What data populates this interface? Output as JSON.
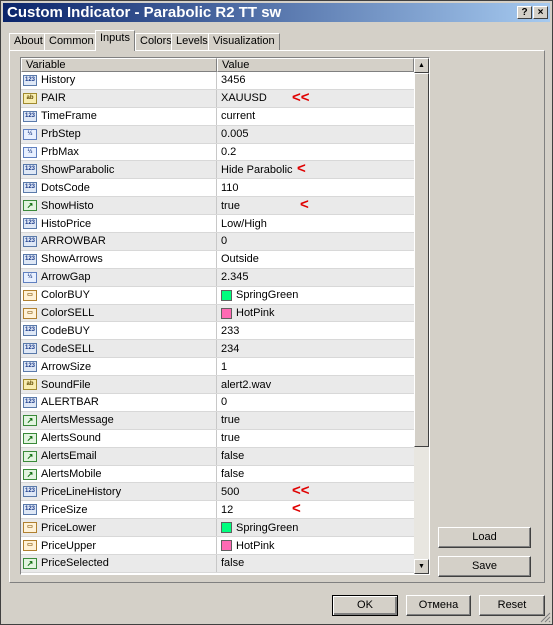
{
  "window": {
    "title": "Custom Indicator - Parabolic R2 TT sw",
    "help_label": "?",
    "close_label": "×"
  },
  "tabs": [
    "About",
    "Common",
    "Inputs",
    "Colors",
    "Levels",
    "Visualization"
  ],
  "active_tab": "Inputs",
  "columns": {
    "variable": "Variable",
    "value": "Value"
  },
  "rows": [
    {
      "variable": "History",
      "value": "3456",
      "type": "int"
    },
    {
      "variable": "PAIR",
      "value": "XAUUSD",
      "type": "str",
      "mark": "<<"
    },
    {
      "variable": "TimeFrame",
      "value": "current",
      "type": "int"
    },
    {
      "variable": "PrbStep",
      "value": "0.005",
      "type": "dbl"
    },
    {
      "variable": "PrbMax",
      "value": "0.2",
      "type": "dbl"
    },
    {
      "variable": "ShowParabolic",
      "value": "Hide Parabolic",
      "type": "int",
      "mark": "<"
    },
    {
      "variable": "DotsCode",
      "value": "110",
      "type": "int"
    },
    {
      "variable": "ShowHisto",
      "value": "true",
      "type": "bool",
      "mark": "<"
    },
    {
      "variable": "HistoPrice",
      "value": "Low/High",
      "type": "int"
    },
    {
      "variable": "ARROWBAR",
      "value": "0",
      "type": "int"
    },
    {
      "variable": "ShowArrows",
      "value": "Outside",
      "type": "int"
    },
    {
      "variable": "ArrowGap",
      "value": "2.345",
      "type": "dbl"
    },
    {
      "variable": "ColorBUY",
      "value": "SpringGreen",
      "type": "color",
      "swatch": "#00ff7f"
    },
    {
      "variable": "ColorSELL",
      "value": "HotPink",
      "type": "color",
      "swatch": "#ff69b4"
    },
    {
      "variable": "CodeBUY",
      "value": "233",
      "type": "int"
    },
    {
      "variable": "CodeSELL",
      "value": "234",
      "type": "int"
    },
    {
      "variable": "ArrowSize",
      "value": "1",
      "type": "int"
    },
    {
      "variable": "SoundFile",
      "value": "alert2.wav",
      "type": "str"
    },
    {
      "variable": "ALERTBAR",
      "value": "0",
      "type": "int"
    },
    {
      "variable": "AlertsMessage",
      "value": "true",
      "type": "bool"
    },
    {
      "variable": "AlertsSound",
      "value": "true",
      "type": "bool"
    },
    {
      "variable": "AlertsEmail",
      "value": "false",
      "type": "bool"
    },
    {
      "variable": "AlertsMobile",
      "value": "false",
      "type": "bool"
    },
    {
      "variable": "PriceLineHistory",
      "value": "500",
      "type": "int",
      "mark": "<<"
    },
    {
      "variable": "PriceSize",
      "value": "12",
      "type": "int",
      "mark": "<"
    },
    {
      "variable": "PriceLower",
      "value": "SpringGreen",
      "type": "color",
      "swatch": "#00ff7f"
    },
    {
      "variable": "PriceUpper",
      "value": "HotPink",
      "type": "color",
      "swatch": "#ff69b4"
    },
    {
      "variable": "PriceSelected",
      "value": "false",
      "type": "bool"
    }
  ],
  "icon_labels": {
    "int": "123",
    "str": "ab",
    "dbl": "½",
    "bool": "↗",
    "color": "▭"
  },
  "buttons": {
    "load": "Load",
    "save": "Save",
    "ok": "OK",
    "cancel": "Отмена",
    "reset": "Reset"
  },
  "colors": {
    "title_start": "#0a246a",
    "title_end": "#a6caf0",
    "annotation": "#e00000"
  }
}
